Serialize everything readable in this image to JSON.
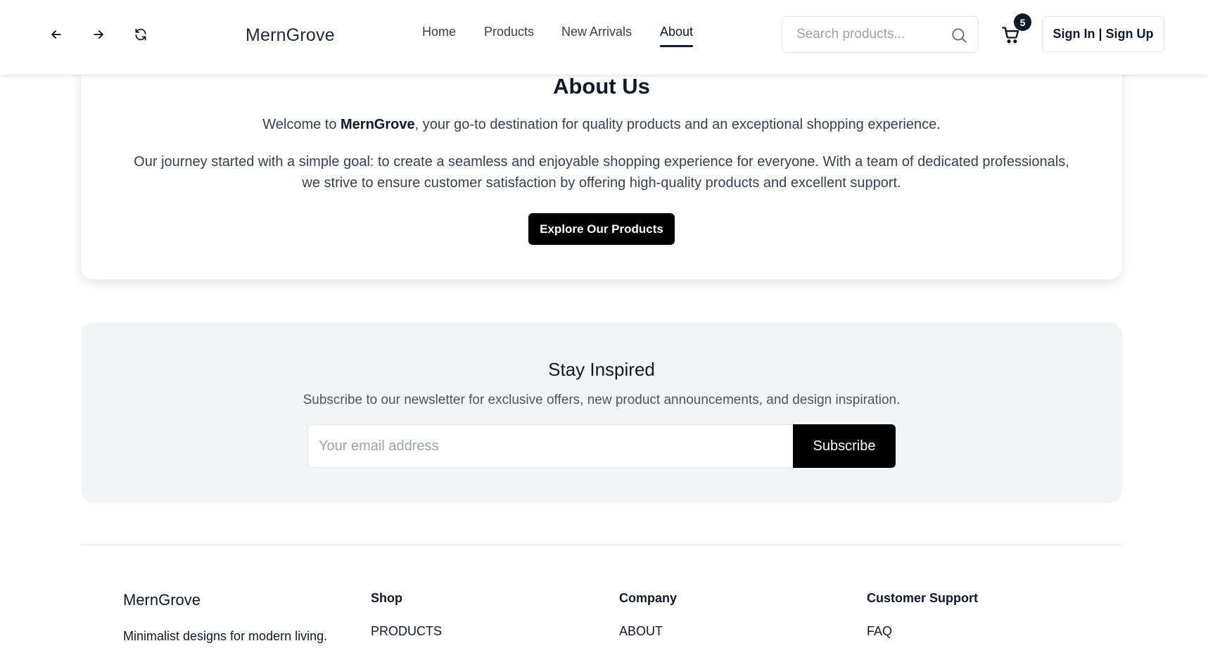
{
  "header": {
    "brand": "MernGrove",
    "nav": [
      {
        "label": "Home"
      },
      {
        "label": "Products"
      },
      {
        "label": "New Arrivals"
      },
      {
        "label": "About",
        "active": true
      }
    ],
    "search_placeholder": "Search products...",
    "cart_count": "5",
    "signin_label": "Sign In | Sign Up",
    "icons": [
      "arrow-left-icon",
      "arrow-right-icon",
      "refresh-icon",
      "search-icon",
      "cart-icon"
    ]
  },
  "about": {
    "title": "About Us",
    "welcome_prefix": "Welcome to ",
    "welcome_brand": "MernGrove",
    "welcome_suffix": ", your go-to destination for quality products and an exceptional shopping experience.",
    "journey": "Our journey started with a simple goal: to create a seamless and enjoyable shopping experience for everyone. With a team of dedicated professionals, we strive to ensure customer satisfaction by offering high-quality products and excellent support.",
    "cta_label": "Explore Our Products"
  },
  "newsletter": {
    "title": "Stay Inspired",
    "text": "Subscribe to our newsletter for exclusive offers, new product announcements, and design inspiration.",
    "email_placeholder": "Your email address",
    "subscribe_label": "Subscribe"
  },
  "footer": {
    "brand": "MernGrove",
    "tagline": "Minimalist designs for modern living.",
    "columns": [
      {
        "title": "Shop",
        "first_link": "PRODUCTS"
      },
      {
        "title": "Company",
        "first_link": "ABOUT"
      },
      {
        "title": "Customer Support",
        "first_link": "FAQ"
      }
    ]
  },
  "colors": {
    "primary": "#000000",
    "text": "#111827",
    "muted": "#4b5563",
    "panel": "#f3f4f6"
  }
}
